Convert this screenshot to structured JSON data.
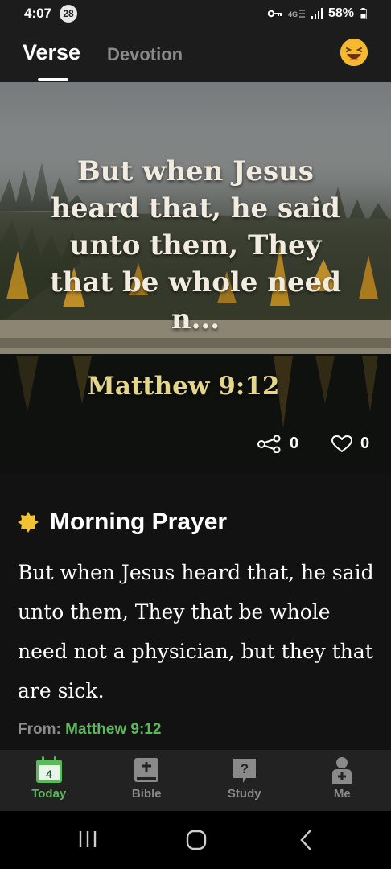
{
  "status_bar": {
    "time": "4:07",
    "notification_count": "28",
    "battery": "58%"
  },
  "tabs": [
    {
      "label": "Verse",
      "active": true
    },
    {
      "label": "Devotion",
      "active": false
    }
  ],
  "verse_card": {
    "text": "But when Jesus heard that, he said unto them, They that be whole need n...",
    "reference": "Matthew 9:12",
    "share_count": "0",
    "like_count": "0"
  },
  "prayer": {
    "title": "Morning Prayer",
    "body": "But when Jesus heard that, he said unto them, They that be whole need not a physician, but they that are sick.",
    "from_label": "From:",
    "from_reference": "Matthew 9:12"
  },
  "bottom_nav": [
    {
      "label": "Today",
      "icon": "calendar-icon",
      "badge": "4",
      "active": true
    },
    {
      "label": "Bible",
      "icon": "bible-icon",
      "active": false
    },
    {
      "label": "Study",
      "icon": "question-icon",
      "active": false
    },
    {
      "label": "Me",
      "icon": "person-icon",
      "active": false
    }
  ],
  "colors": {
    "accent_green": "#5cb85c",
    "reference_gold": "#e4d58a",
    "sun_yellow": "#f2c230"
  }
}
